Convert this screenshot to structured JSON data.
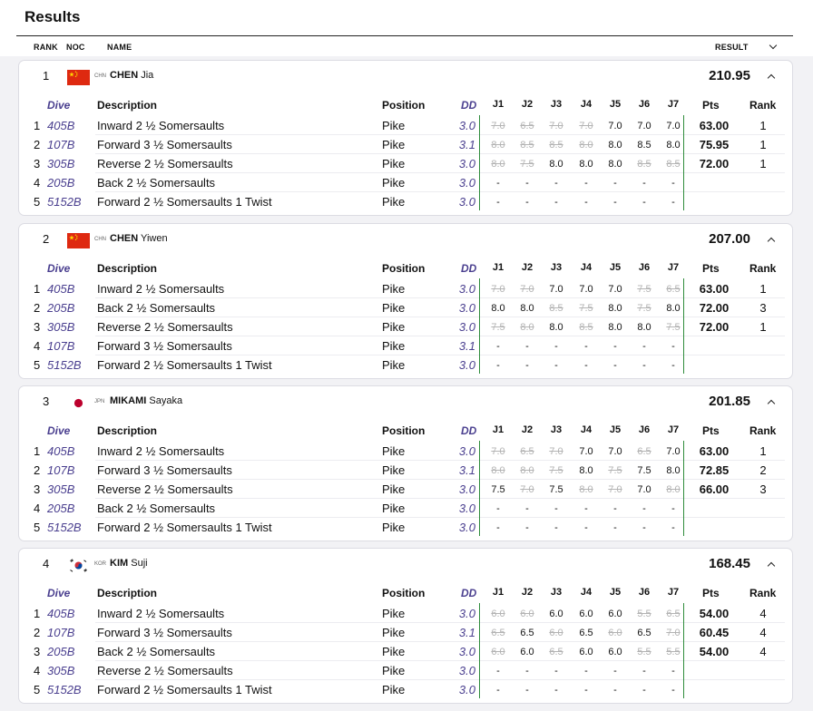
{
  "page": {
    "title": "Results"
  },
  "columns": {
    "rank": "RANK",
    "noc": "NOC",
    "name": "NAME",
    "result": "RESULT"
  },
  "table_headers": {
    "dive": "Dive",
    "description": "Description",
    "position": "Position",
    "dd": "DD",
    "judges": [
      "J1",
      "J2",
      "J3",
      "J4",
      "J5",
      "J6",
      "J7"
    ],
    "pts": "Pts",
    "rank": "Rank"
  },
  "colors": {
    "accent": "#4a3f8f",
    "divider": "#2f8c3c",
    "struck": "#b3b3b3"
  },
  "athletes": [
    {
      "rank": "1",
      "noc": "CHN",
      "flag": "china-flag-icon",
      "surname": "CHEN",
      "given": "Jia",
      "total": "210.95",
      "dives": [
        {
          "n": "1",
          "code": "405B",
          "desc": "Inward 2 ½ Somersaults",
          "pos": "Pike",
          "dd": "3.0",
          "scores": [
            "7.0",
            "6.5",
            "7.0",
            "7.0",
            "7.0",
            "7.0",
            "7.0"
          ],
          "struck": [
            true,
            true,
            true,
            true,
            false,
            false,
            false
          ],
          "pts": "63.00",
          "rank": "1"
        },
        {
          "n": "2",
          "code": "107B",
          "desc": "Forward 3 ½ Somersaults",
          "pos": "Pike",
          "dd": "3.1",
          "scores": [
            "8.0",
            "8.5",
            "8.5",
            "8.0",
            "8.0",
            "8.5",
            "8.0"
          ],
          "struck": [
            true,
            true,
            true,
            true,
            false,
            false,
            false
          ],
          "pts": "75.95",
          "rank": "1"
        },
        {
          "n": "3",
          "code": "305B",
          "desc": "Reverse 2 ½ Somersaults",
          "pos": "Pike",
          "dd": "3.0",
          "scores": [
            "8.0",
            "7.5",
            "8.0",
            "8.0",
            "8.0",
            "8.5",
            "8.5"
          ],
          "struck": [
            true,
            true,
            false,
            false,
            false,
            true,
            true
          ],
          "pts": "72.00",
          "rank": "1"
        },
        {
          "n": "4",
          "code": "205B",
          "desc": "Back 2 ½ Somersaults",
          "pos": "Pike",
          "dd": "3.0",
          "scores": [
            "-",
            "-",
            "-",
            "-",
            "-",
            "-",
            "-"
          ],
          "struck": [
            false,
            false,
            false,
            false,
            false,
            false,
            false
          ],
          "pts": "",
          "rank": ""
        },
        {
          "n": "5",
          "code": "5152B",
          "desc": "Forward 2 ½ Somersaults 1 Twist",
          "pos": "Pike",
          "dd": "3.0",
          "scores": [
            "-",
            "-",
            "-",
            "-",
            "-",
            "-",
            "-"
          ],
          "struck": [
            false,
            false,
            false,
            false,
            false,
            false,
            false
          ],
          "pts": "",
          "rank": ""
        }
      ]
    },
    {
      "rank": "2",
      "noc": "CHN",
      "flag": "china-flag-icon",
      "surname": "CHEN",
      "given": "Yiwen",
      "total": "207.00",
      "dives": [
        {
          "n": "1",
          "code": "405B",
          "desc": "Inward 2 ½ Somersaults",
          "pos": "Pike",
          "dd": "3.0",
          "scores": [
            "7.0",
            "7.0",
            "7.0",
            "7.0",
            "7.0",
            "7.5",
            "6.5"
          ],
          "struck": [
            true,
            true,
            false,
            false,
            false,
            true,
            true
          ],
          "pts": "63.00",
          "rank": "1"
        },
        {
          "n": "2",
          "code": "205B",
          "desc": "Back 2 ½ Somersaults",
          "pos": "Pike",
          "dd": "3.0",
          "scores": [
            "8.0",
            "8.0",
            "8.5",
            "7.5",
            "8.0",
            "7.5",
            "8.0"
          ],
          "struck": [
            false,
            false,
            true,
            true,
            false,
            true,
            false
          ],
          "pts": "72.00",
          "rank": "3"
        },
        {
          "n": "3",
          "code": "305B",
          "desc": "Reverse 2 ½ Somersaults",
          "pos": "Pike",
          "dd": "3.0",
          "scores": [
            "7.5",
            "8.0",
            "8.0",
            "8.5",
            "8.0",
            "8.0",
            "7.5"
          ],
          "struck": [
            true,
            true,
            false,
            true,
            false,
            false,
            true
          ],
          "pts": "72.00",
          "rank": "1"
        },
        {
          "n": "4",
          "code": "107B",
          "desc": "Forward 3 ½ Somersaults",
          "pos": "Pike",
          "dd": "3.1",
          "scores": [
            "-",
            "-",
            "-",
            "-",
            "-",
            "-",
            "-"
          ],
          "struck": [
            false,
            false,
            false,
            false,
            false,
            false,
            false
          ],
          "pts": "",
          "rank": ""
        },
        {
          "n": "5",
          "code": "5152B",
          "desc": "Forward 2 ½ Somersaults 1 Twist",
          "pos": "Pike",
          "dd": "3.0",
          "scores": [
            "-",
            "-",
            "-",
            "-",
            "-",
            "-",
            "-"
          ],
          "struck": [
            false,
            false,
            false,
            false,
            false,
            false,
            false
          ],
          "pts": "",
          "rank": ""
        }
      ]
    },
    {
      "rank": "3",
      "noc": "JPN",
      "flag": "japan-flag-icon",
      "surname": "MIKAMI",
      "given": "Sayaka",
      "total": "201.85",
      "dives": [
        {
          "n": "1",
          "code": "405B",
          "desc": "Inward 2 ½ Somersaults",
          "pos": "Pike",
          "dd": "3.0",
          "scores": [
            "7.0",
            "6.5",
            "7.0",
            "7.0",
            "7.0",
            "6.5",
            "7.0"
          ],
          "struck": [
            true,
            true,
            true,
            false,
            false,
            true,
            false
          ],
          "pts": "63.00",
          "rank": "1"
        },
        {
          "n": "2",
          "code": "107B",
          "desc": "Forward 3 ½ Somersaults",
          "pos": "Pike",
          "dd": "3.1",
          "scores": [
            "8.0",
            "8.0",
            "7.5",
            "8.0",
            "7.5",
            "7.5",
            "8.0"
          ],
          "struck": [
            true,
            true,
            true,
            false,
            true,
            false,
            false
          ],
          "pts": "72.85",
          "rank": "2"
        },
        {
          "n": "3",
          "code": "305B",
          "desc": "Reverse 2 ½ Somersaults",
          "pos": "Pike",
          "dd": "3.0",
          "scores": [
            "7.5",
            "7.0",
            "7.5",
            "8.0",
            "7.0",
            "7.0",
            "8.0"
          ],
          "struck": [
            false,
            true,
            false,
            true,
            true,
            false,
            true
          ],
          "pts": "66.00",
          "rank": "3"
        },
        {
          "n": "4",
          "code": "205B",
          "desc": "Back 2 ½ Somersaults",
          "pos": "Pike",
          "dd": "3.0",
          "scores": [
            "-",
            "-",
            "-",
            "-",
            "-",
            "-",
            "-"
          ],
          "struck": [
            false,
            false,
            false,
            false,
            false,
            false,
            false
          ],
          "pts": "",
          "rank": ""
        },
        {
          "n": "5",
          "code": "5152B",
          "desc": "Forward 2 ½ Somersaults 1 Twist",
          "pos": "Pike",
          "dd": "3.0",
          "scores": [
            "-",
            "-",
            "-",
            "-",
            "-",
            "-",
            "-"
          ],
          "struck": [
            false,
            false,
            false,
            false,
            false,
            false,
            false
          ],
          "pts": "",
          "rank": ""
        }
      ]
    },
    {
      "rank": "4",
      "noc": "KOR",
      "flag": "korea-flag-icon",
      "surname": "KIM",
      "given": "Suji",
      "total": "168.45",
      "dives": [
        {
          "n": "1",
          "code": "405B",
          "desc": "Inward 2 ½ Somersaults",
          "pos": "Pike",
          "dd": "3.0",
          "scores": [
            "6.0",
            "6.0",
            "6.0",
            "6.0",
            "6.0",
            "5.5",
            "6.5"
          ],
          "struck": [
            true,
            true,
            false,
            false,
            false,
            true,
            true
          ],
          "pts": "54.00",
          "rank": "4"
        },
        {
          "n": "2",
          "code": "107B",
          "desc": "Forward 3 ½ Somersaults",
          "pos": "Pike",
          "dd": "3.1",
          "scores": [
            "6.5",
            "6.5",
            "6.0",
            "6.5",
            "6.0",
            "6.5",
            "7.0"
          ],
          "struck": [
            true,
            false,
            true,
            false,
            true,
            false,
            true
          ],
          "pts": "60.45",
          "rank": "4"
        },
        {
          "n": "3",
          "code": "205B",
          "desc": "Back 2 ½ Somersaults",
          "pos": "Pike",
          "dd": "3.0",
          "scores": [
            "6.0",
            "6.0",
            "6.5",
            "6.0",
            "6.0",
            "5.5",
            "5.5"
          ],
          "struck": [
            true,
            false,
            true,
            false,
            false,
            true,
            true
          ],
          "pts": "54.00",
          "rank": "4"
        },
        {
          "n": "4",
          "code": "305B",
          "desc": "Reverse 2 ½ Somersaults",
          "pos": "Pike",
          "dd": "3.0",
          "scores": [
            "-",
            "-",
            "-",
            "-",
            "-",
            "-",
            "-"
          ],
          "struck": [
            false,
            false,
            false,
            false,
            false,
            false,
            false
          ],
          "pts": "",
          "rank": ""
        },
        {
          "n": "5",
          "code": "5152B",
          "desc": "Forward 2 ½ Somersaults 1 Twist",
          "pos": "Pike",
          "dd": "3.0",
          "scores": [
            "-",
            "-",
            "-",
            "-",
            "-",
            "-",
            "-"
          ],
          "struck": [
            false,
            false,
            false,
            false,
            false,
            false,
            false
          ],
          "pts": "",
          "rank": ""
        }
      ]
    }
  ]
}
